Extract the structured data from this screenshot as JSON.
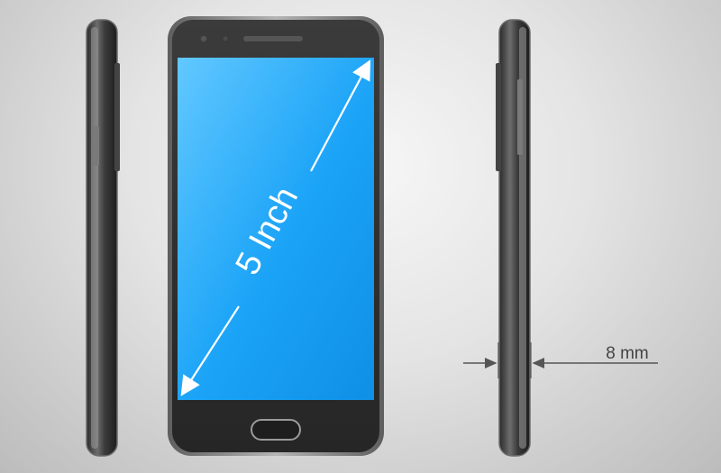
{
  "diagonal_label": "5 Inch",
  "thickness_label": "8 mm",
  "colors": {
    "screen": "#1aa3f7",
    "screen_light": "#5cc2ff",
    "body": "#2f2f2f",
    "frame": "#8a8a8a",
    "annotation": "#4a4a4a"
  }
}
